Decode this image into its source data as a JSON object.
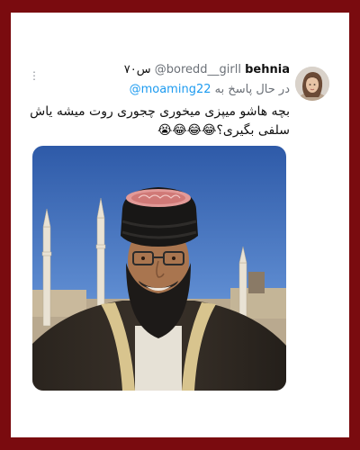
{
  "tweet": {
    "display_name": "behnia",
    "handle": "@boredd__girll",
    "time": "۷۰س",
    "reply_prefix": "در حال پاسخ به",
    "reply_mention": "@moaming22",
    "text_line1": "بچه هاشو میپزی میخوری چجوری روت میشه یاش",
    "text_line2": "سلفی بگیری؟😂😂😂😭"
  },
  "icons": {
    "more": "more-options-icon",
    "avatar": "profile-avatar"
  },
  "colors": {
    "outer_frame": "#7a0b0f",
    "card": "#ffffff",
    "mention": "#1d9bf0",
    "muted": "#6b7077"
  }
}
